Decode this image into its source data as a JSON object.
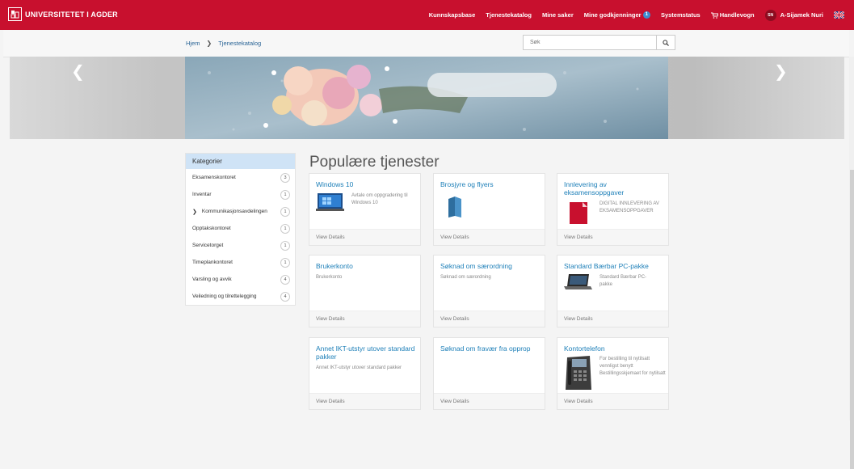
{
  "header": {
    "logo_text": "UNIVERSITETET I AGDER",
    "nav": [
      "Kunnskapsbase",
      "Tjenestekatalog",
      "Mine saker",
      "Mine godkjenninger"
    ],
    "approvals_badge": "1",
    "status": "Systemstatus",
    "cart": "Handlevogn",
    "avatar_initials": "SN",
    "user": "A-Sijamek Nuri"
  },
  "breadcrumb": {
    "home": "Hjem",
    "current": "Tjenestekatalog"
  },
  "search": {
    "placeholder": "Søk"
  },
  "sidebar": {
    "title": "Kategorier",
    "items": [
      {
        "label": "Eksamenskontoret",
        "count": "3"
      },
      {
        "label": "Inventar",
        "count": "1"
      },
      {
        "label": "Kommunikasjonsavdelingen",
        "count": "1"
      },
      {
        "label": "Opptakskontoret",
        "count": "1"
      },
      {
        "label": "Servicetorget",
        "count": "1"
      },
      {
        "label": "Timeplankontoret",
        "count": "1"
      },
      {
        "label": "Varsling og avvik",
        "count": "4"
      },
      {
        "label": "Veiledning og tilrettelegging",
        "count": "4"
      }
    ]
  },
  "main": {
    "title": "Populære tjenester",
    "view_details": "View Details",
    "cards": [
      {
        "title": "Windows 10",
        "desc": "Avtale om oppgradering til Windows 10"
      },
      {
        "title": "Brosjyre og flyers",
        "desc": ""
      },
      {
        "title": "Innlevering av eksamensoppgaver",
        "desc": "DIGITAL INNLEVERING AV EKSAMENSOPPGAVER"
      },
      {
        "title": "Brukerkonto",
        "desc": "Brukerkonto"
      },
      {
        "title": "Søknad om særordning",
        "desc": "Søknad om særordning"
      },
      {
        "title": "Standard Bærbar PC-pakke",
        "desc": "Standard Bærbar PC-pakke"
      },
      {
        "title": "Annet IKT-utstyr utover standard pakker",
        "desc": "Annet IKT-utstyr utover standard pakker"
      },
      {
        "title": "Søknad om fravær fra opprop",
        "desc": ""
      },
      {
        "title": "Kontortelefon",
        "desc": "For bestilling til nytilsatt vennligst benytt Bestillingsskjemaet for nytilsatt"
      }
    ]
  },
  "colors": {
    "brand": "#c8102e",
    "link": "#1d7fb8",
    "sidebar_header": "#cfe3f6"
  }
}
